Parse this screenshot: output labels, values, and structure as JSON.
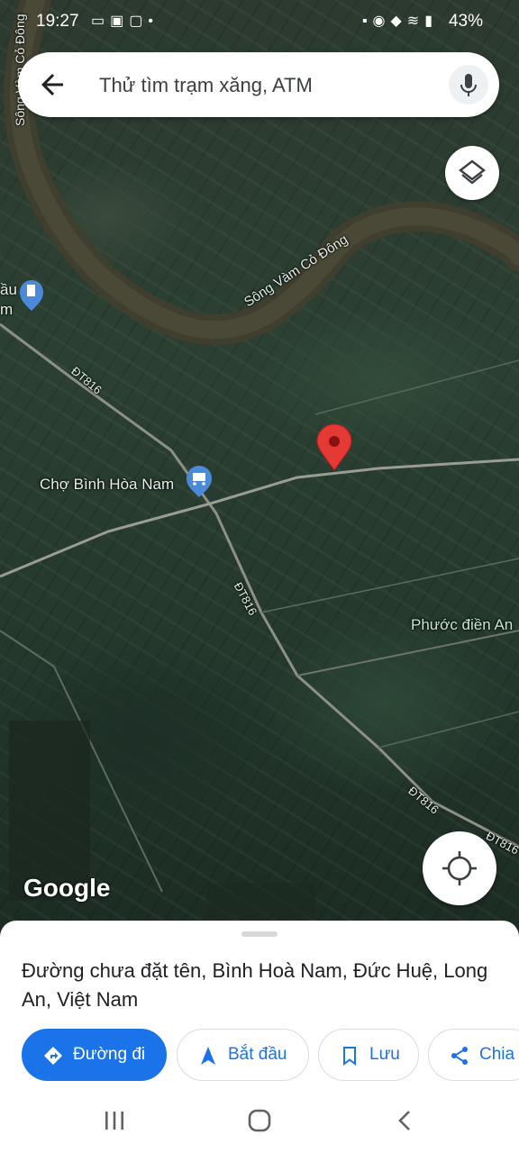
{
  "status_bar": {
    "time": "19:27",
    "left_icons": [
      "message-icon",
      "gallery-icon",
      "zalo-icon",
      "dot-icon"
    ],
    "right_icons": [
      "lock-icon",
      "alarm-icon",
      "location-icon",
      "wifi-icon",
      "signal-icon"
    ],
    "battery": "43%"
  },
  "search": {
    "placeholder": "Thử tìm trạm xăng, ATM"
  },
  "map": {
    "labels": {
      "river_vertical": "Sông Vàm Cỏ Đông",
      "river_curve": "Sông Vàm Cỏ Đông",
      "left_edge_top": "ầu",
      "left_edge_bottom": "m",
      "market": "Chợ Bình Hòa Nam",
      "road_1": "ĐT816",
      "road_2": "ĐT816",
      "road_3": "ĐT816",
      "road_4": "ĐT816",
      "place": "Phước điền An"
    },
    "attribution": "Google",
    "pin_color": "#e53935",
    "poi_color": "#4a8ad8"
  },
  "place_sheet": {
    "address": "Đường chưa đặt tên, Bình Hoà Nam, Đức Huệ, Long An, Việt Nam",
    "buttons": {
      "directions": "Đường đi",
      "start": "Bắt đầu",
      "save": "Lưu",
      "share": "Chia"
    }
  },
  "nav": {
    "recent_icon": "recent-apps-icon",
    "home_icon": "home-icon",
    "back_icon": "back-icon"
  }
}
